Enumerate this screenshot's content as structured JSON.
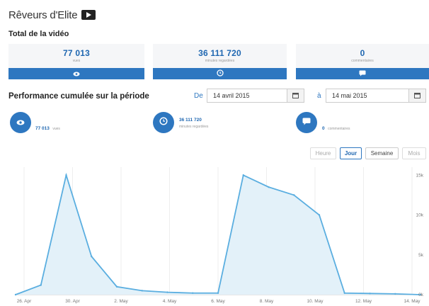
{
  "header": {
    "channel_name": "Rêveurs d'Elite"
  },
  "total": {
    "title": "Total de la vidéo",
    "cards": [
      {
        "value": "77 013",
        "label": "vues",
        "icon": "eye-icon"
      },
      {
        "value": "36 111 720",
        "label": "minutes regardées",
        "icon": "clock-icon"
      },
      {
        "value": "0",
        "label": "commentaires",
        "icon": "comment-icon"
      }
    ]
  },
  "performance": {
    "title": "Performance cumulée sur la période",
    "from_label": "De",
    "from_date": "14 avril 2015",
    "to_label": "à",
    "to_date": "14 mai 2015",
    "metrics": [
      {
        "value": "77 013",
        "label": "vues"
      },
      {
        "value": "36 111 720",
        "label": "minutes regardées"
      },
      {
        "value": "0",
        "label": "commentaires"
      }
    ]
  },
  "granularity": {
    "options": [
      "Heure",
      "Jour",
      "Semaine",
      "Mois"
    ],
    "selected": "Jour"
  },
  "colors": {
    "accent": "#2e77c0",
    "line": "#5aaee0",
    "fill": "#e3f1f9"
  },
  "chart_data": {
    "type": "area",
    "x": [
      "26 Apr",
      "27 Apr",
      "28 Apr",
      "29 Apr",
      "30 Apr",
      "1 May",
      "2 May",
      "3 May",
      "4 May",
      "5 May",
      "6 May",
      "7 May",
      "8 May",
      "9 May",
      "10 May",
      "11 May",
      "12 May",
      "13 May",
      "14 May"
    ],
    "values": [
      0,
      1200,
      15000,
      4800,
      1000,
      500,
      300,
      200,
      200,
      15000,
      13500,
      12500,
      10000,
      200,
      150,
      100,
      0
    ],
    "x_tick_labels": [
      "26. Apr",
      "30. Apr",
      "2. May",
      "4. May",
      "6. May",
      "8. May",
      "10. May",
      "12. May",
      "14. May"
    ],
    "y_tick_labels": [
      "0k",
      "5k",
      "10k",
      "15k"
    ],
    "ylim": [
      0,
      16000
    ],
    "grid": true
  }
}
